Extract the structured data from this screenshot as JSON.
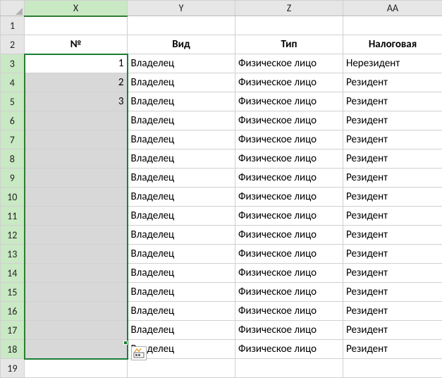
{
  "columns": {
    "X": "X",
    "Y": "Y",
    "Z": "Z",
    "AA": "AA"
  },
  "row_numbers": [
    "1",
    "2",
    "3",
    "4",
    "5",
    "6",
    "7",
    "8",
    "9",
    "10",
    "11",
    "12",
    "13",
    "14",
    "15",
    "16",
    "17",
    "18",
    "19"
  ],
  "header_row": {
    "num": "№",
    "vid": "Вид",
    "tip": "Тип",
    "nal": "Налоговая"
  },
  "active_column": "X",
  "selection": {
    "col": "X",
    "row_start": 3,
    "row_end": 18
  },
  "quick_analysis_icon": "quick-analysis-icon",
  "rows": [
    {
      "r": 3,
      "num": "1",
      "vid": "Владелец",
      "tip": "Физическое лицо",
      "nal": "Нерезидент"
    },
    {
      "r": 4,
      "num": "2",
      "vid": "Владелец",
      "tip": "Физическое лицо",
      "nal": "Резидент"
    },
    {
      "r": 5,
      "num": "3",
      "vid": "Владелец",
      "tip": "Физическое лицо",
      "nal": "Резидент"
    },
    {
      "r": 6,
      "num": "",
      "vid": "Владелец",
      "tip": "Физическое лицо",
      "nal": "Резидент"
    },
    {
      "r": 7,
      "num": "",
      "vid": "Владелец",
      "tip": "Физическое лицо",
      "nal": "Резидент"
    },
    {
      "r": 8,
      "num": "",
      "vid": "Владелец",
      "tip": "Физическое лицо",
      "nal": "Резидент"
    },
    {
      "r": 9,
      "num": "",
      "vid": "Владелец",
      "tip": "Физическое лицо",
      "nal": "Резидент"
    },
    {
      "r": 10,
      "num": "",
      "vid": "Владелец",
      "tip": "Физическое лицо",
      "nal": "Резидент"
    },
    {
      "r": 11,
      "num": "",
      "vid": "Владелец",
      "tip": "Физическое лицо",
      "nal": "Резидент"
    },
    {
      "r": 12,
      "num": "",
      "vid": "Владелец",
      "tip": "Физическое лицо",
      "nal": "Резидент"
    },
    {
      "r": 13,
      "num": "",
      "vid": "Владелец",
      "tip": "Физическое лицо",
      "nal": "Резидент"
    },
    {
      "r": 14,
      "num": "",
      "vid": "Владелец",
      "tip": "Физическое лицо",
      "nal": "Резидент"
    },
    {
      "r": 15,
      "num": "",
      "vid": "Владелец",
      "tip": "Физическое лицо",
      "nal": "Резидент"
    },
    {
      "r": 16,
      "num": "",
      "vid": "Владелец",
      "tip": "Физическое лицо",
      "nal": "Резидент"
    },
    {
      "r": 17,
      "num": "",
      "vid": "Владелец",
      "tip": "Физическое лицо",
      "nal": "Резидент"
    },
    {
      "r": 18,
      "num": "",
      "vid": "Владелец",
      "tip": "Физическое лицо",
      "nal": "Резидент"
    }
  ]
}
